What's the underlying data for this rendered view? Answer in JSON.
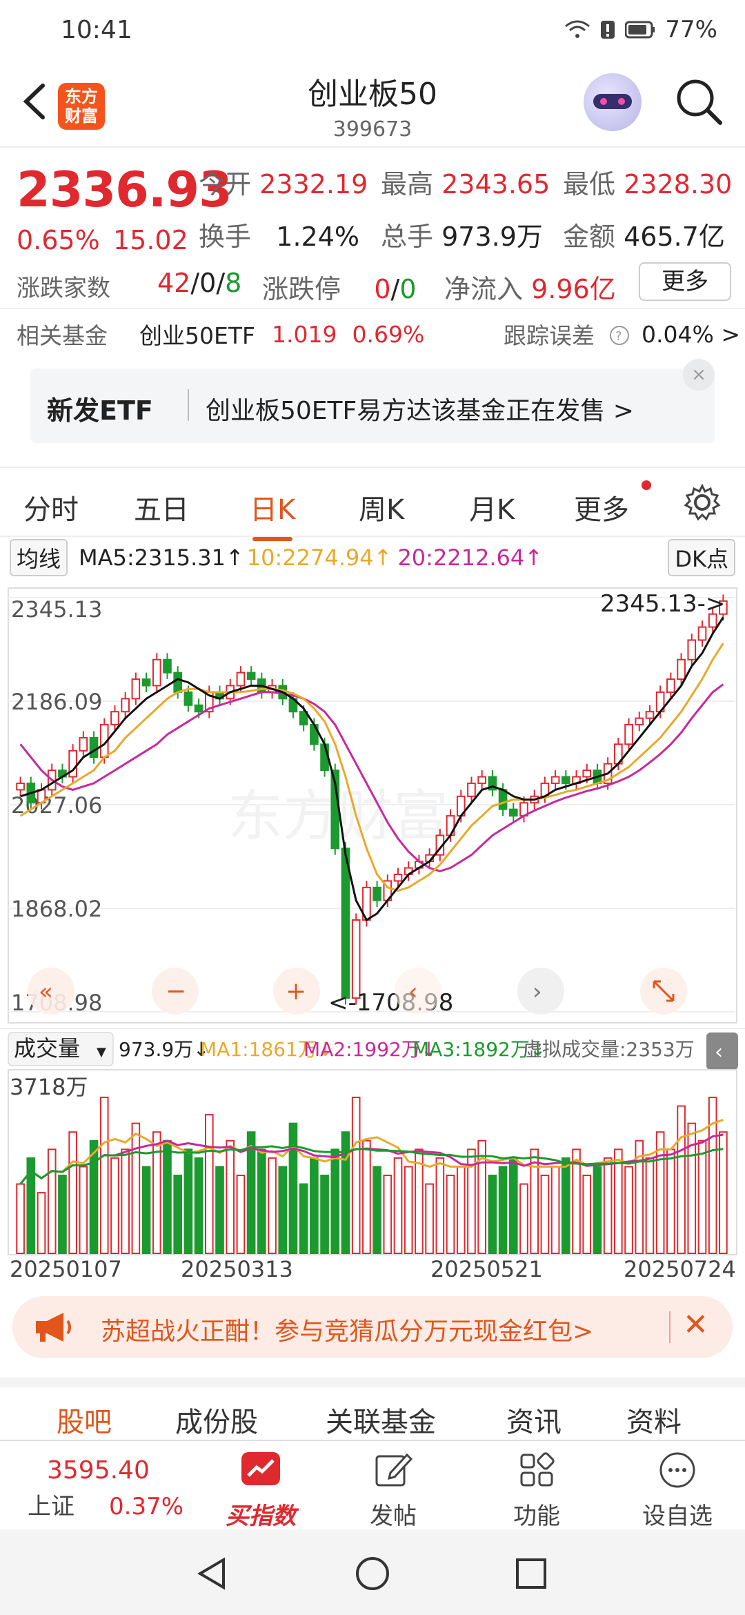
{
  "status": {
    "time": "10:41",
    "battery": "77%"
  },
  "header": {
    "logo_line1": "东方",
    "logo_line2": "财富",
    "title": "创业板50",
    "code": "399673"
  },
  "quote": {
    "price": "2336.93",
    "change_pct": "0.65%",
    "change_amt": "15.02",
    "open_label": "今开",
    "open": "2332.19",
    "high_label": "最高",
    "high": "2343.65",
    "low_label": "最低",
    "low": "2328.30",
    "turnover_label": "换手",
    "turnover": "1.24%",
    "volume_label": "总手",
    "volume": "973.9万",
    "amount_label": "金额",
    "amount": "465.7亿",
    "breadth_label": "涨跌家数",
    "up": "42",
    "flat": "0",
    "down": "8",
    "limit_label": "涨跌停",
    "limit_up": "0",
    "limit_down": "0",
    "netflow_label": "净流入",
    "netflow": "9.96亿",
    "more": "更多",
    "slash": "/"
  },
  "fund": {
    "label": "相关基金",
    "name": "创业50ETF",
    "price": "1.019",
    "pct": "0.69%",
    "track_label": "跟踪误差",
    "track_value": "0.04% >"
  },
  "banner": {
    "tag": "新发ETF",
    "text": "创业板50ETF易方达该基金正在发售  >",
    "close": "×"
  },
  "ktabs": [
    "分时",
    "五日",
    "日K",
    "周K",
    "月K",
    "更多"
  ],
  "ma": {
    "selector": "均线",
    "ma5": "MA5:2315.31↑",
    "ma10": "10:2274.94↑",
    "ma20": "20:2212.64↑",
    "dk": "DK点"
  },
  "chart_data": {
    "type": "candlestick",
    "y_ticks": [
      "2345.13",
      "2186.09",
      "2027.06",
      "1868.02",
      "1708.98"
    ],
    "ylim": [
      1708.98,
      2345.13
    ],
    "max_label": "2345.13->",
    "min_label": "<-1708.98",
    "watermark": "东方财富",
    "colors": {
      "up": "#e0282f",
      "down": "#1b9a2f",
      "ma5": "#111111",
      "ma10": "#e8a92a",
      "ma20": "#c8289a"
    },
    "closes": [
      2060,
      2030,
      2050,
      2080,
      2070,
      2110,
      2130,
      2100,
      2150,
      2170,
      2190,
      2220,
      2210,
      2250,
      2230,
      2200,
      2180,
      2170,
      2200,
      2190,
      2210,
      2230,
      2220,
      2200,
      2210,
      2190,
      2170,
      2150,
      2120,
      2080,
      1960,
      1730,
      1850,
      1900,
      1880,
      1910,
      1920,
      1930,
      1940,
      1950,
      1980,
      2010,
      2040,
      2060,
      2070,
      2050,
      2020,
      2010,
      2030,
      2040,
      2060,
      2070,
      2060,
      2070,
      2080,
      2060,
      2090,
      2120,
      2150,
      2160,
      2170,
      2200,
      2220,
      2250,
      2280,
      2300,
      2320,
      2340
    ],
    "ma5": [
      2040,
      2045,
      2050,
      2060,
      2070,
      2080,
      2100,
      2110,
      2120,
      2140,
      2160,
      2175,
      2190,
      2200,
      2210,
      2220,
      2215,
      2205,
      2195,
      2190,
      2200,
      2205,
      2210,
      2210,
      2205,
      2200,
      2190,
      2175,
      2150,
      2120,
      2060,
      1950,
      1880,
      1850,
      1860,
      1880,
      1900,
      1920,
      1930,
      1940,
      1960,
      1980,
      2010,
      2030,
      2050,
      2055,
      2050,
      2040,
      2035,
      2035,
      2040,
      2050,
      2055,
      2060,
      2065,
      2070,
      2075,
      2090,
      2110,
      2130,
      2150,
      2170,
      2190,
      2210,
      2240,
      2260,
      2290,
      2315
    ],
    "ma10": [
      2010,
      2020,
      2030,
      2040,
      2050,
      2060,
      2070,
      2080,
      2100,
      2110,
      2130,
      2145,
      2160,
      2175,
      2190,
      2200,
      2205,
      2205,
      2200,
      2200,
      2200,
      2200,
      2202,
      2205,
      2205,
      2203,
      2198,
      2190,
      2175,
      2155,
      2120,
      2070,
      2010,
      1960,
      1920,
      1900,
      1895,
      1900,
      1910,
      1920,
      1935,
      1955,
      1975,
      1995,
      2010,
      2025,
      2030,
      2035,
      2035,
      2035,
      2038,
      2042,
      2047,
      2050,
      2055,
      2060,
      2065,
      2075,
      2085,
      2100,
      2115,
      2130,
      2150,
      2170,
      2195,
      2220,
      2250,
      2275
    ],
    "ma20": [
      2120,
      2100,
      2080,
      2065,
      2055,
      2050,
      2055,
      2060,
      2070,
      2080,
      2090,
      2100,
      2110,
      2120,
      2135,
      2145,
      2155,
      2165,
      2175,
      2180,
      2185,
      2190,
      2195,
      2200,
      2200,
      2198,
      2195,
      2190,
      2182,
      2170,
      2150,
      2120,
      2090,
      2060,
      2030,
      2000,
      1975,
      1955,
      1940,
      1930,
      1925,
      1930,
      1940,
      1950,
      1965,
      1980,
      1990,
      2000,
      2010,
      2018,
      2025,
      2032,
      2038,
      2043,
      2048,
      2052,
      2057,
      2063,
      2070,
      2080,
      2092,
      2105,
      2120,
      2138,
      2160,
      2180,
      2200,
      2212
    ]
  },
  "volume": {
    "selector": "成交量",
    "vol": "973.9万↓",
    "ma1": "MA1:1861万↓",
    "ma2": "MA2:1992万↓",
    "ma3": "MA3:1892万↓",
    "virtual": "虚拟成交量:2353万",
    "max_label": "3718万",
    "dates": [
      "20250107",
      "20250313",
      "20250521",
      "20250724"
    ],
    "values": [
      40,
      55,
      35,
      60,
      45,
      70,
      50,
      65,
      90,
      55,
      60,
      75,
      50,
      70,
      65,
      45,
      60,
      55,
      80,
      50,
      65,
      45,
      70,
      60,
      55,
      50,
      75,
      40,
      55,
      45,
      60,
      70,
      90,
      65,
      50,
      45,
      55,
      50,
      60,
      40,
      55,
      45,
      50,
      60,
      65,
      45,
      50,
      55,
      40,
      60,
      45,
      50,
      55,
      60,
      45,
      50,
      55,
      60,
      50,
      65,
      55,
      70,
      60,
      85,
      75,
      65,
      90,
      70
    ]
  },
  "promo": {
    "text": "苏超战火正酣！参与竞猜瓜分万元现金红包>",
    "close": "✕"
  },
  "btabs": [
    "股吧",
    "成份股",
    "关联基金",
    "资讯",
    "资料"
  ],
  "bottombar": {
    "sh_price": "3595.40",
    "sh_label": "上证",
    "sh_pct": "0.37%",
    "buy": "买指数",
    "post": "发帖",
    "func": "功能",
    "watch": "设自选"
  }
}
